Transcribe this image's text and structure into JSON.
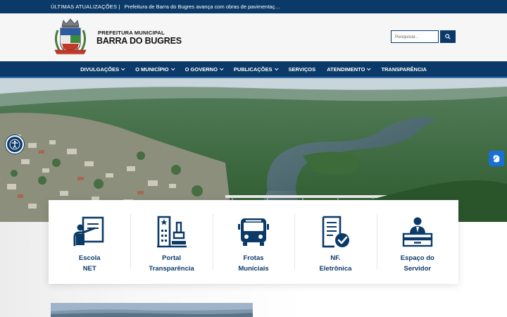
{
  "ticker": {
    "label": "ÚLTIMAS ATUALIZAÇÕES |",
    "headline": "Prefeitura de Barra do Bugres avança com obras de pavimentação e ..."
  },
  "header": {
    "brand_line1": "PREFEITURA MUNICIPAL",
    "brand_line2": "BARRA DO BUGRES",
    "search_placeholder": "Pesquisar..."
  },
  "nav": [
    {
      "label": "DIVULGAÇÕES",
      "dropdown": true
    },
    {
      "label": "O MUNICÍPIO",
      "dropdown": true
    },
    {
      "label": "O GOVERNO",
      "dropdown": true
    },
    {
      "label": "PUBLICAÇÕES",
      "dropdown": true
    },
    {
      "label": "SERVIÇOS",
      "dropdown": false
    },
    {
      "label": "ATENDIMENTO",
      "dropdown": true
    },
    {
      "label": "TRANSPARÊNCIA",
      "dropdown": false
    }
  ],
  "services": [
    {
      "line1": "Escola",
      "line2": "NET",
      "icon": "teacher-board-icon"
    },
    {
      "line1": "Portal",
      "line2": "Transparência",
      "icon": "building-stamp-icon"
    },
    {
      "line1": "Frotas",
      "line2": "Municiais",
      "icon": "bus-icon"
    },
    {
      "line1": "NF.",
      "line2": "Eletrônica",
      "icon": "invoice-check-icon"
    },
    {
      "line1": "Espaço do",
      "line2": "Servidor",
      "icon": "employee-desk-icon"
    }
  ],
  "colors": {
    "primary": "#0b3a68",
    "accent": "#3a6fb0",
    "libras": "#1a6fd6"
  }
}
